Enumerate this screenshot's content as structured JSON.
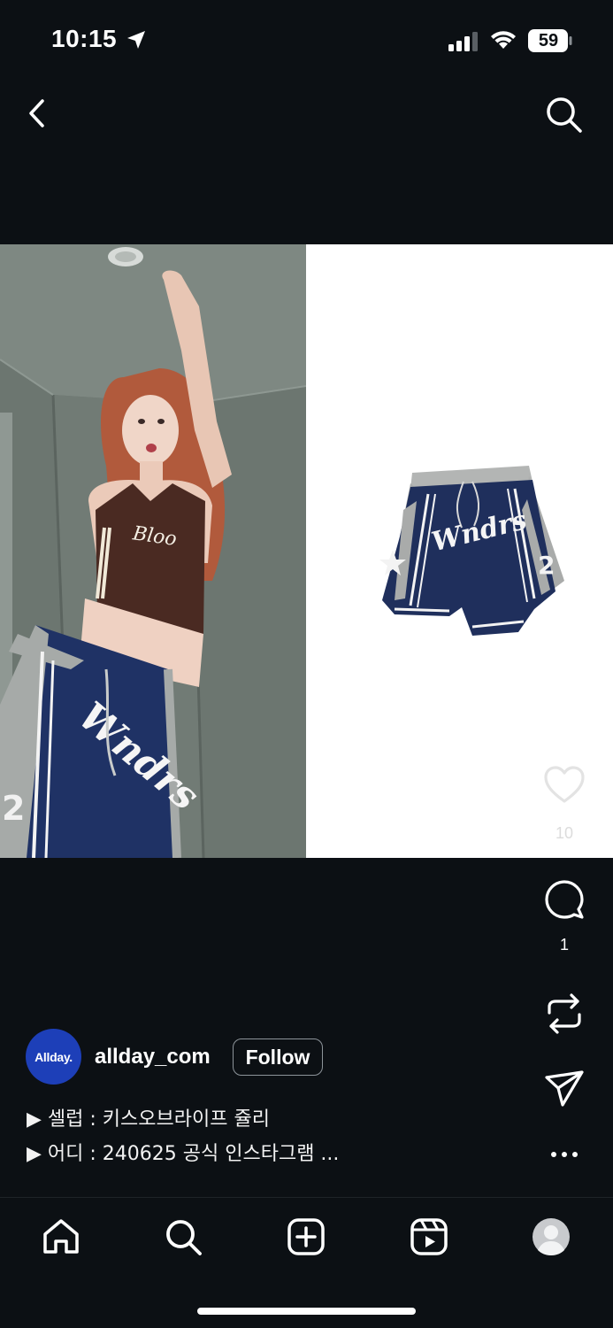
{
  "status_bar": {
    "time": "10:15",
    "battery": "59"
  },
  "header": {
    "back_icon": "chevron-left-icon",
    "search_icon": "search-icon"
  },
  "post": {
    "likes": "10",
    "comments": "1",
    "username": "allday_com",
    "avatar_text": "Allday.",
    "follow_label": "Follow",
    "caption_lines": [
      "▶ 셀럽 : 키스오브라이프 쥴리",
      "▶ 어디 : 240625 공식 인스타그램 ..."
    ],
    "product_text": "Wndrs",
    "product_number": "2"
  },
  "nav": {
    "items": [
      "home-icon",
      "search-icon",
      "create-icon",
      "reels-icon",
      "profile-icon"
    ]
  },
  "colors": {
    "background": "#0c1014",
    "avatar": "#1d3fb8",
    "shorts_navy": "#1f2f5c",
    "shorts_grey": "#a9abaa"
  }
}
